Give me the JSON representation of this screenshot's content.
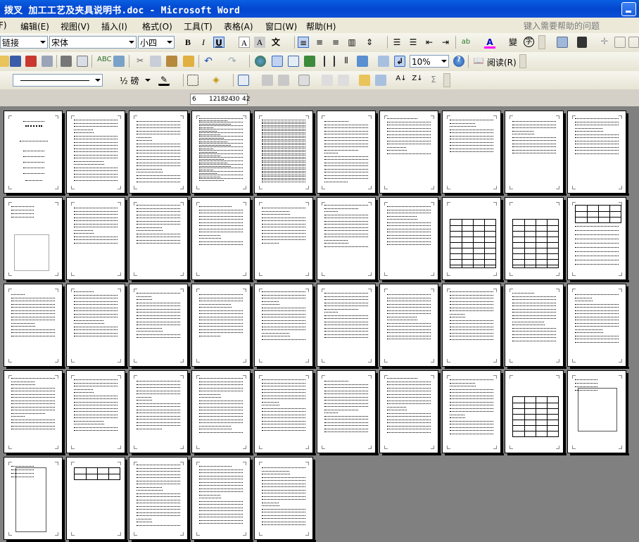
{
  "window": {
    "title": "拨叉 加工工艺及夹具说明书.doc - Microsoft Word"
  },
  "menu": {
    "items": [
      {
        "label": "F)"
      },
      {
        "label": "编辑(E)"
      },
      {
        "label": "视图(V)"
      },
      {
        "label": "插入(I)"
      },
      {
        "label": "格式(O)"
      },
      {
        "label": "工具(T)"
      },
      {
        "label": "表格(A)"
      },
      {
        "label": "窗口(W)"
      },
      {
        "label": "帮助(H)"
      }
    ],
    "help_placeholder": "键入需要帮助的问题"
  },
  "formatting": {
    "style": "链接",
    "font": "宋体",
    "size": "小四",
    "bold": "B",
    "italic": "I",
    "underline": "U",
    "char_border": "A",
    "char_shade": "A",
    "wen": "文",
    "font_color": "A"
  },
  "standard": {
    "zoom": "10%",
    "read_label": "阅读(R)"
  },
  "drawing": {
    "line_weight": "½ 磅"
  },
  "ruler": {
    "labels": [
      "6",
      "12",
      "18",
      "24",
      "30",
      "42"
    ]
  },
  "document": {
    "page_count": 45,
    "columns": 10,
    "rows": 5
  }
}
